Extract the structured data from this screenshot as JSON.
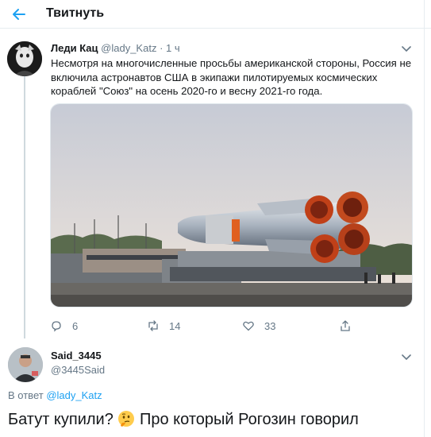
{
  "header": {
    "title": "Твитнуть",
    "back_icon": "arrow-left-icon",
    "accent": "#1da1f2"
  },
  "tweet1": {
    "author_name": "Леди Кац",
    "author_handle": "@lady_Katz",
    "separator": " · ",
    "time": "1 ч",
    "text": "Несмотря на многочисленные просьбы американской стороны, Россия не включила астронавтов США в экипажи пилотируемых космических кораблей \"Союз\" на осень 2020-го и весну 2021-го года.",
    "media_icon": "soyuz-rocket-photo",
    "actions": {
      "replies": "6",
      "retweets": "14",
      "likes": "33"
    }
  },
  "tweet2": {
    "author_name": "Said_3445",
    "author_handle": "@3445Said",
    "reply_prefix": "В ответ",
    "reply_to": "@lady_Katz",
    "text_part1": "Батут купили?",
    "text_part2": "Про который Рогозин говорил",
    "emoji_icon": "thinking-face-icon"
  }
}
